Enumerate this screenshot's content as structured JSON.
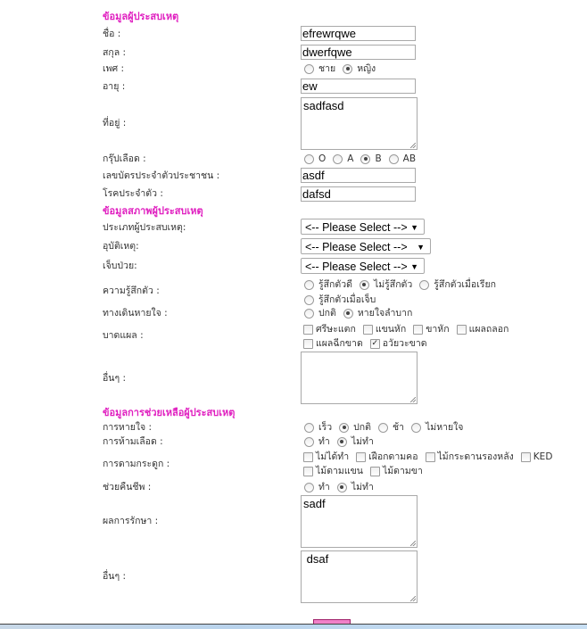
{
  "section1": {
    "heading": "ข้อมูลผู้ประสบเหตุ",
    "first_name_label": "ชื่อ :",
    "first_name": "efrewrqwe",
    "last_name_label": "สกุล :",
    "last_name": "dwerfqwe",
    "gender_label": "เพศ :",
    "gender_options": [
      "ชาย",
      "หญิง"
    ],
    "gender_selected": "หญิง",
    "age_label": "อายุ :",
    "age": "ew",
    "address_label": "ที่อยู่ :",
    "address": "sadfasd",
    "blood_label": "กรุ๊ปเลือด :",
    "blood_options": [
      "O",
      "A",
      "B",
      "AB"
    ],
    "blood_selected": "B",
    "id_label": "เลขบัตรประจำตัวประชาชน :",
    "id": "asdf",
    "disease_label": "โรคประจำตัว :",
    "disease": "dafsd"
  },
  "section2": {
    "heading": "ข้อมูลสภาพผู้ประสบเหตุ",
    "type_label": "ประเภทผู้ประสบเหตุ:",
    "type_value": "<-- Please Select -->",
    "accident_label": "อุบัติเหตุ:",
    "accident_value": "<-- Please Select -->",
    "illness_label": "เจ็บป่วย:",
    "illness_value": "<-- Please Select -->",
    "consciousness_label": "ความรู้สึกตัว :",
    "consciousness_options": [
      "รู้สึกตัวดี",
      "ไม่รู้สึกตัว",
      "รู้สึกตัวเมื่อเรียก",
      "รู้สึกตัวเมื่อเจ็บ"
    ],
    "consciousness_selected": "ไม่รู้สึกตัว",
    "airway_label": "ทางเดินหายใจ :",
    "airway_options": [
      "ปกติ",
      "หายใจลำบาก"
    ],
    "airway_selected": "หายใจลำบาก",
    "wound_label": "บาดแผล :",
    "wound_options": [
      "ศรีษะแตก",
      "แขนหัก",
      "ขาหัก",
      "แผลถลอก",
      "แผลฉีกขาด",
      "อวัยวะขาด"
    ],
    "wound_checked": [
      "อวัยวะขาด"
    ],
    "other_label": "อื่นๆ :",
    "other": ""
  },
  "section3": {
    "heading": "ข้อมูลการช่วยเหลือผู้ประสบเหตุ",
    "breathing_label": "การหายใจ :",
    "breathing_options": [
      "เร็ว",
      "ปกติ",
      "ช้า",
      "ไม่หายใจ"
    ],
    "breathing_selected": "ปกติ",
    "bleeding_label": "การห้ามเลือด :",
    "bleeding_options": [
      "ทำ",
      "ไม่ทำ"
    ],
    "bleeding_selected": "ไม่ทำ",
    "splint_label": "การดามกระดูก :",
    "splint_options": [
      "ไม่ได้ทำ",
      "เฝือกดามคอ",
      "ไม้กระดานรองหลัง",
      "KED",
      "ไม้ดามแขน",
      "ไม้ดามขา"
    ],
    "cpr_label": "ช่วยคืนชีพ :",
    "cpr_options": [
      "ทำ",
      "ไม่ทำ"
    ],
    "cpr_selected": "ไม่ทำ",
    "result_label": "ผลการรักษา :",
    "result": "sadf",
    "other_label": "อื่นๆ :",
    "other": " dsaf"
  }
}
